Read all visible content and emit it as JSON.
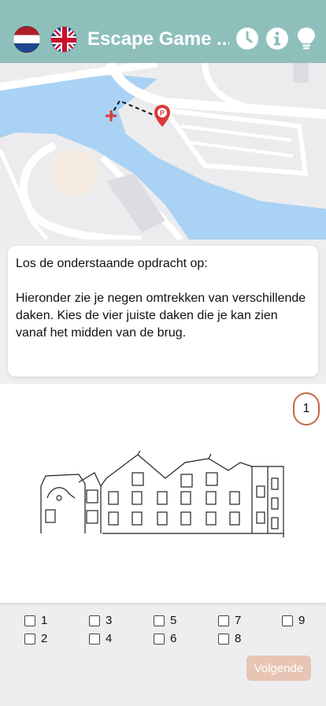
{
  "header": {
    "title": "Escape Game ...",
    "background": "#8fbfbb",
    "icons": [
      "flag-nl-icon",
      "flag-uk-icon",
      "clock-icon",
      "info-icon",
      "lightbulb-icon"
    ]
  },
  "map": {
    "water_color": "#a9d2f4",
    "marker_icon": "parking-pin-icon",
    "cross_icon": "red-cross-icon"
  },
  "task": {
    "text": "Los de onderstaande opdracht op:\n\nHieronder zie je negen omtrekken van verschillende daken. Kies de vier juiste daken die je kan zien vanaf het midden van de brug."
  },
  "sketch": {
    "counter": "1",
    "accent": "#c06a45"
  },
  "options": [
    "1",
    "2",
    "3",
    "4",
    "5",
    "6",
    "7",
    "8",
    "9"
  ],
  "buttons": {
    "next": "Volgende",
    "next_color": "#e8c4b4"
  }
}
